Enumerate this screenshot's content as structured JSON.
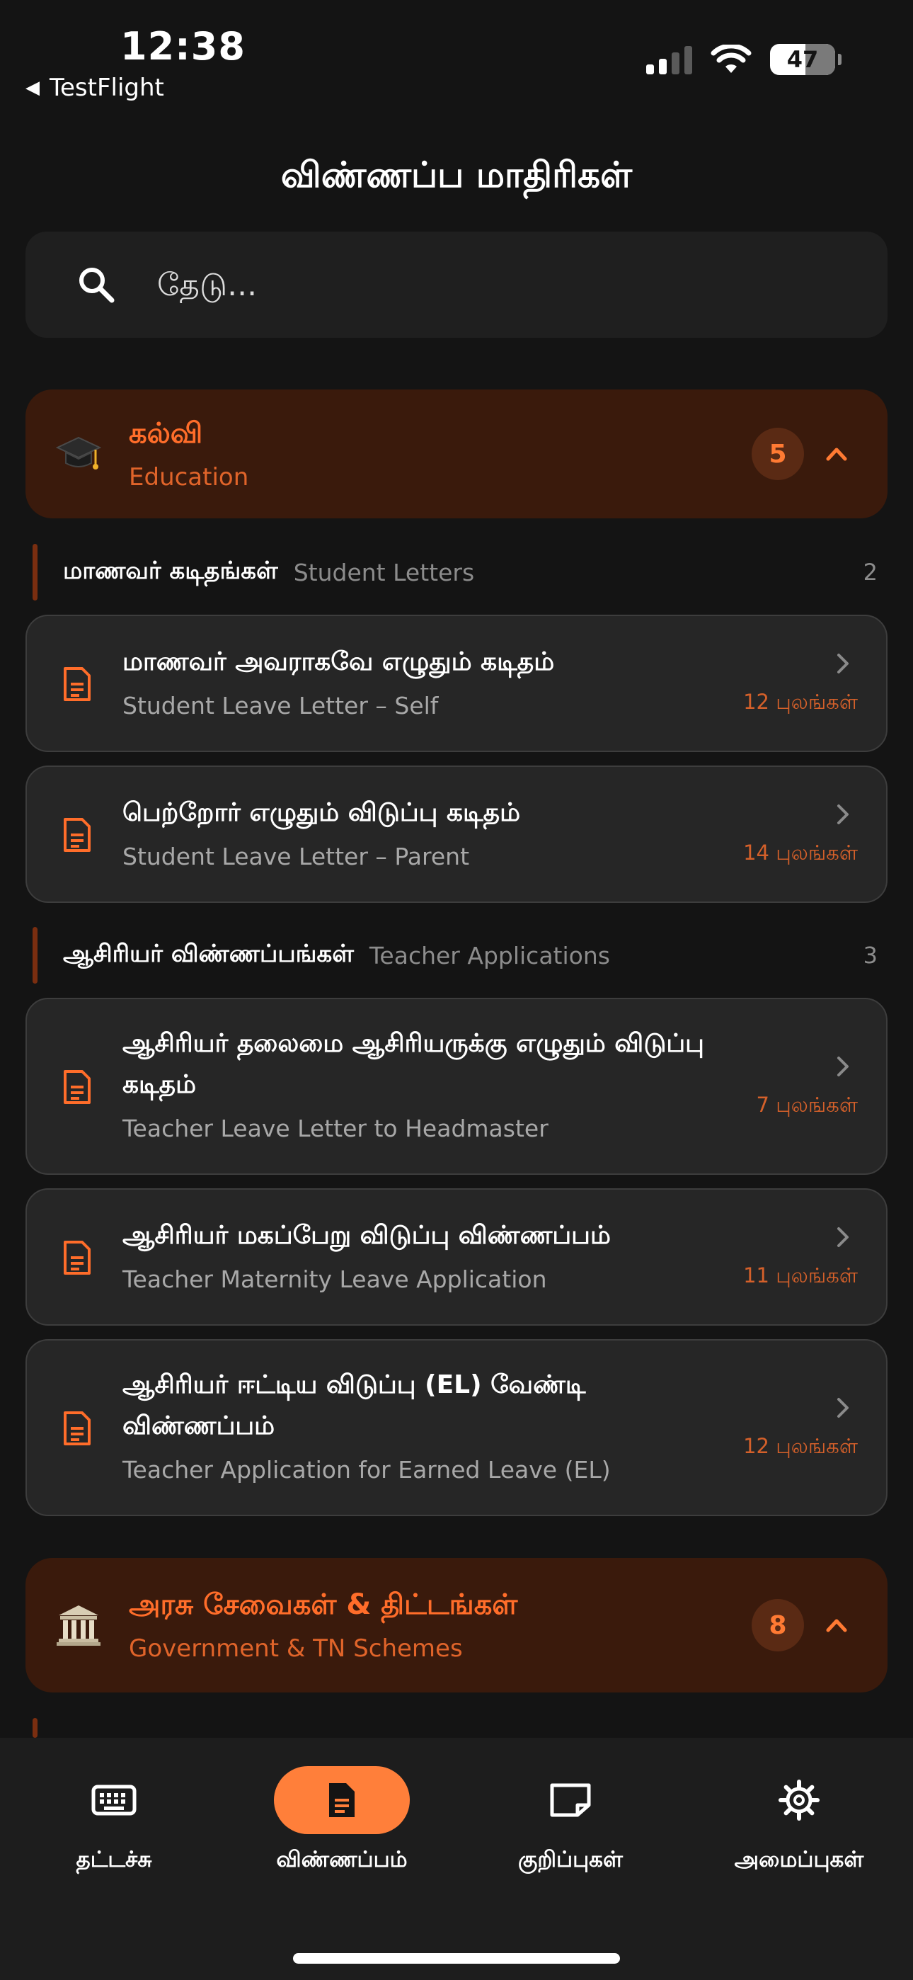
{
  "status": {
    "time": "12:38",
    "back_label": "TestFlight",
    "battery": "47"
  },
  "page": {
    "title": "விண்ணப்ப மாதிரிகள்"
  },
  "search": {
    "placeholder": "தேடு..."
  },
  "categories": [
    {
      "title_ta": "கல்வி",
      "title_en": "Education",
      "count": "5",
      "icon": "graduation-cap-icon",
      "sections": [
        {
          "title_ta": "மாணவர் கடிதங்கள்",
          "title_en": "Student Letters",
          "count": "2",
          "items": [
            {
              "title_ta": "மாணவர் அவராகவே எழுதும் கடிதம்",
              "title_en": "Student Leave Letter – Self",
              "fields": "12 புலங்கள்"
            },
            {
              "title_ta": "பெற்றோர் எழுதும் விடுப்பு கடிதம்",
              "title_en": "Student Leave Letter – Parent",
              "fields": "14 புலங்கள்"
            }
          ]
        },
        {
          "title_ta": "ஆசிரியர் விண்ணப்பங்கள்",
          "title_en": "Teacher Applications",
          "count": "3",
          "items": [
            {
              "title_ta": "ஆசிரியர் தலைமை ஆசிரியருக்கு எழுதும் விடுப்பு கடிதம்",
              "title_en": "Teacher Leave Letter to Headmaster",
              "fields": "7 புலங்கள்"
            },
            {
              "title_ta": "ஆசிரியர் மகப்பேறு விடுப்பு விண்ணப்பம்",
              "title_en": "Teacher Maternity Leave Application",
              "fields": "11 புலங்கள்"
            },
            {
              "title_ta": "ஆசிரியர் ஈட்டிய விடுப்பு (EL) வேண்டி விண்ணப்பம்",
              "title_en": "Teacher Application for Earned Leave (EL)",
              "fields": "12 புலங்கள்"
            }
          ]
        }
      ]
    },
    {
      "title_ta": "அரசு சேவைகள் & திட்டங்கள்",
      "title_en": "Government & TN Schemes",
      "count": "8",
      "icon": "government-building-icon"
    }
  ],
  "nav": [
    {
      "label": "தட்டச்சு",
      "icon": "keyboard-icon",
      "active": false
    },
    {
      "label": "விண்ணப்பம்",
      "icon": "document-icon",
      "active": true
    },
    {
      "label": "குறிப்புகள்",
      "icon": "note-icon",
      "active": false
    },
    {
      "label": "அமைப்புகள்",
      "icon": "settings-icon",
      "active": false
    }
  ],
  "colors": {
    "accent": "#ff7f3a",
    "category_bg": "#3a1a0c",
    "card_bg": "#262626",
    "background": "#141414"
  }
}
